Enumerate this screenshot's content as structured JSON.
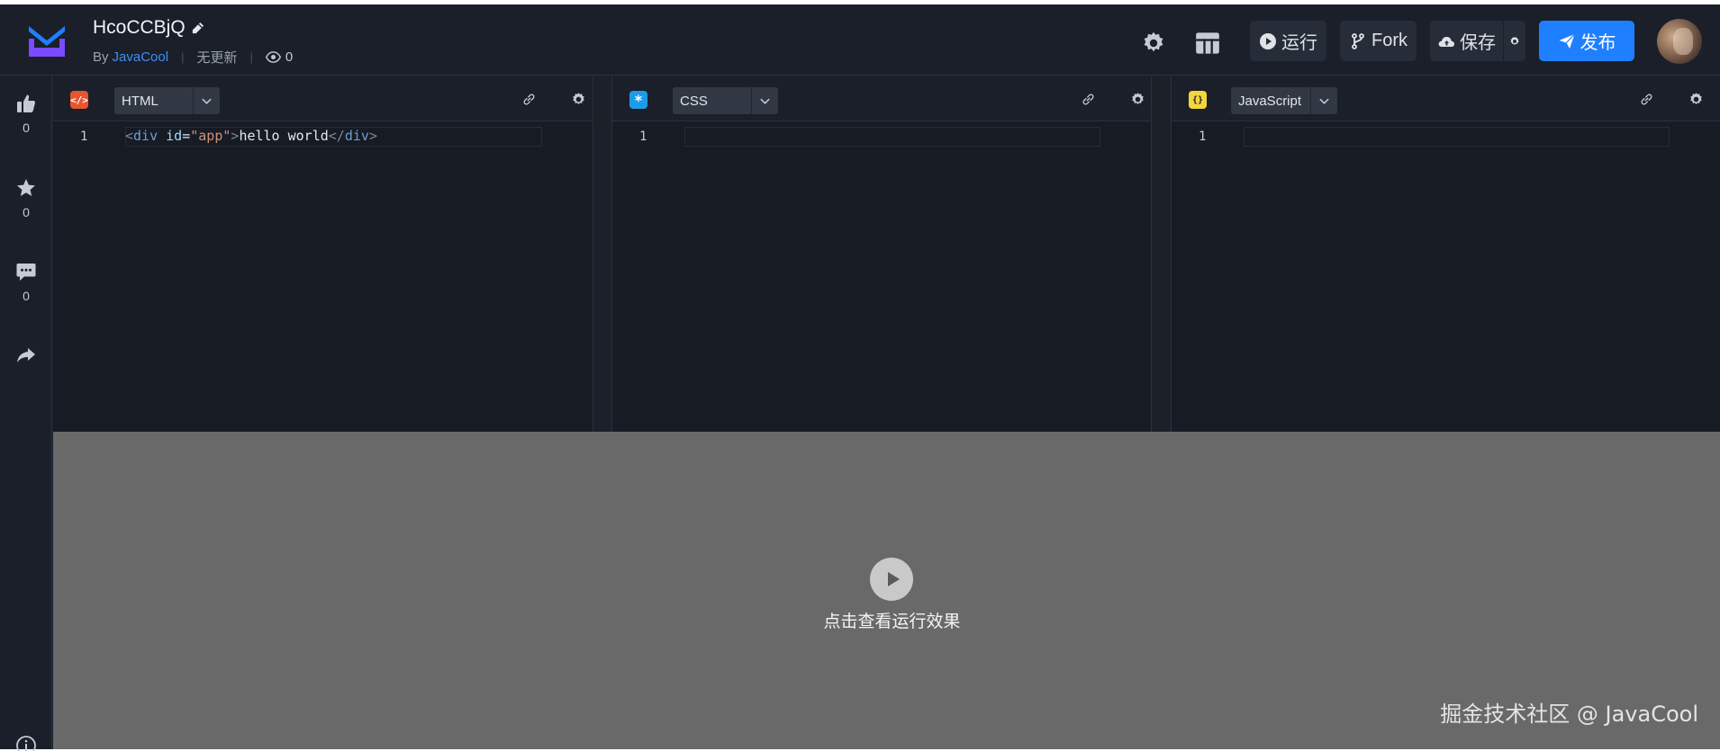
{
  "header": {
    "title": "HcoCCBjQ",
    "by_prefix": "By",
    "author": "JavaCool",
    "update_status": "无更新",
    "views": "0",
    "buttons": {
      "run": "运行",
      "fork": "Fork",
      "save": "保存",
      "publish": "发布"
    }
  },
  "sidebar": {
    "like_count": "0",
    "star_count": "0",
    "comment_count": "0"
  },
  "editors": [
    {
      "lang": "HTML",
      "badge": "</>",
      "badge_color": "#e8542f",
      "line_number": "1"
    },
    {
      "lang": "CSS",
      "badge": "*",
      "badge_color": "#1e9be8",
      "line_number": "1"
    },
    {
      "lang": "JavaScript",
      "badge": "{}",
      "badge_color": "#f5d53c",
      "line_number": "1"
    }
  ],
  "html_code": {
    "open_tag": "div",
    "attr": "id",
    "value": "\"app\"",
    "content": "hello world",
    "close_tag": "div"
  },
  "preview": {
    "hint": "点击查看运行效果",
    "watermark": "掘金技术社区 @ JavaCool"
  },
  "colors": {
    "accent": "#1e80ff",
    "background": "#1b2029",
    "preview_bg": "#696969"
  }
}
